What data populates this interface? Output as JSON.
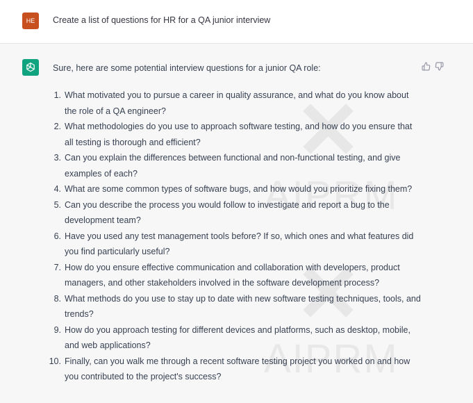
{
  "user": {
    "avatar_initials": "HE",
    "avatar_color": "#c8501e",
    "message": "Create a list of questions for HR for a QA junior interview"
  },
  "assistant": {
    "avatar_icon": "openai-logo-icon",
    "avatar_color": "#10a37f",
    "intro": "Sure, here are some potential interview questions for a junior QA role:",
    "questions": [
      {
        "num": "1.",
        "text": "What motivated you to pursue a career in quality assurance, and what do you know about the role of a QA engineer?"
      },
      {
        "num": "2.",
        "text": "What methodologies do you use to approach software testing, and how do you ensure that all testing is thorough and efficient?"
      },
      {
        "num": "3.",
        "text": "Can you explain the differences between functional and non-functional testing, and give examples of each?"
      },
      {
        "num": "4.",
        "text": "What are some common types of software bugs, and how would you prioritize fixing them?"
      },
      {
        "num": "5.",
        "text": "Can you describe the process you would follow to investigate and report a bug to the development team?"
      },
      {
        "num": "6.",
        "text": "Have you used any test management tools before? If so, which ones and what features did you find particularly useful?"
      },
      {
        "num": "7.",
        "text": "How do you ensure effective communication and collaboration with developers, product managers, and other stakeholders involved in the software development process?"
      },
      {
        "num": "8.",
        "text": "What methods do you use to stay up to date with new software testing techniques, tools, and trends?"
      },
      {
        "num": "9.",
        "text": "How do you approach testing for different devices and platforms, such as desktop, mobile, and web applications?"
      },
      {
        "num": "10.",
        "text": "Finally, can you walk me through a recent software testing project you worked on and how you contributed to the project's success?"
      }
    ],
    "feedback_icons": [
      "thumbs-up-icon",
      "thumbs-down-icon"
    ]
  },
  "watermark": {
    "text": "AIPRM"
  }
}
